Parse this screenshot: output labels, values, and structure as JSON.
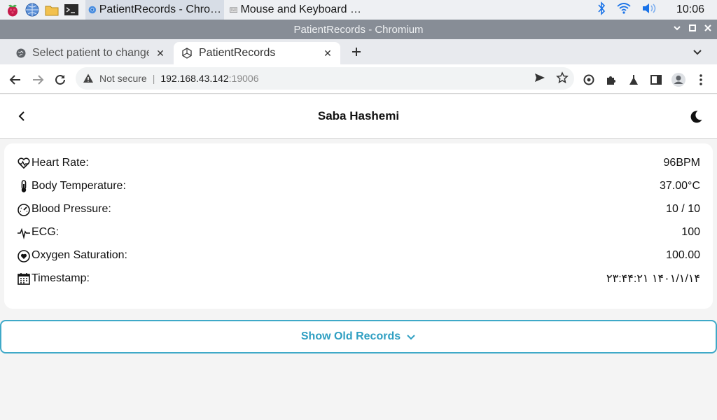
{
  "taskbar": {
    "tasks": [
      {
        "label": "PatientRecords - Chro…",
        "active": true
      },
      {
        "label": "Mouse and Keyboard …",
        "active": false
      }
    ],
    "clock": "10:06"
  },
  "window": {
    "title": "PatientRecords - Chromium"
  },
  "tabs": [
    {
      "title": "Select patient to change",
      "active": false
    },
    {
      "title": "PatientRecords",
      "active": true
    }
  ],
  "address_bar": {
    "security": "Not secure",
    "host": "192.168.43.142",
    "port": ":19006"
  },
  "app": {
    "patient_name": "Saba Hashemi",
    "vitals": [
      {
        "icon": "heart-rate-icon",
        "label": "Heart Rate:",
        "value": "96BPM"
      },
      {
        "icon": "thermometer-icon",
        "label": "Body Temperature:",
        "value": "37.00°C"
      },
      {
        "icon": "gauge-icon",
        "label": "Blood Pressure:",
        "value": "10 / 10"
      },
      {
        "icon": "ecg-icon",
        "label": "ECG:",
        "value": "100"
      },
      {
        "icon": "oxygen-icon",
        "label": "Oxygen Saturation:",
        "value": "100.00"
      },
      {
        "icon": "calendar-icon",
        "label": "Timestamp:",
        "value": "۱۴۰۱/۱/۱۴ ۲۳:۴۴:۲۱"
      }
    ],
    "show_old_records_label": "Show Old Records"
  },
  "colors": {
    "accent": "#3fa9c8",
    "titlebar": "#878d96"
  }
}
